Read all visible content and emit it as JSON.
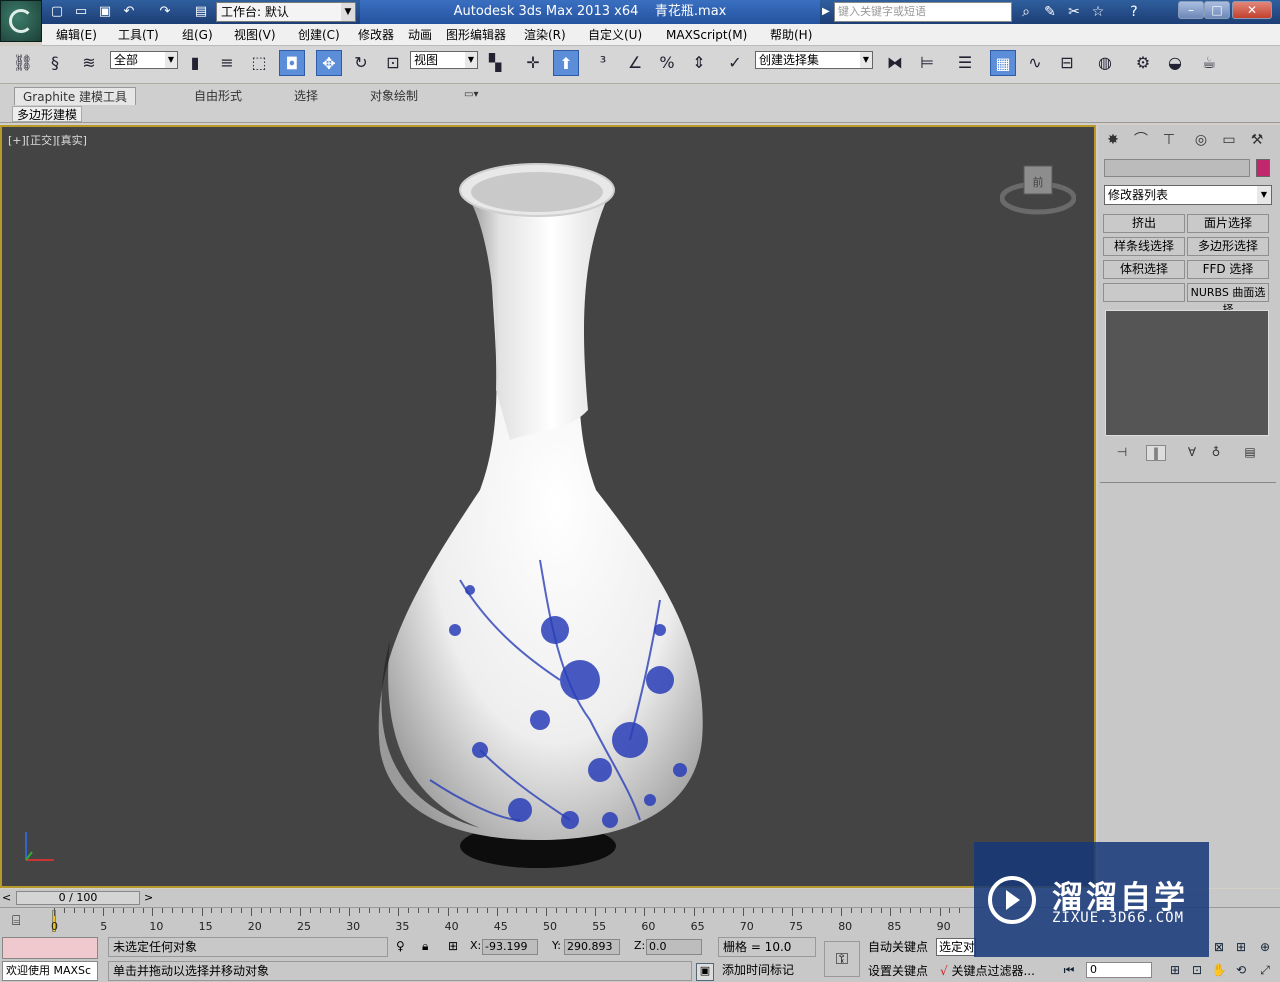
{
  "window": {
    "app_title": "Autodesk 3ds Max  2013 x64",
    "file_name": "青花瓶.max",
    "workspace_label": "工作台: 默认",
    "search_placeholder": "键入关键字或短语",
    "minimize": "–",
    "maximize": "□",
    "close": "✕"
  },
  "menu": [
    "编辑(E)",
    "工具(T)",
    "组(G)",
    "视图(V)",
    "创建(C)",
    "修改器",
    "动画",
    "图形编辑器",
    "渲染(R)",
    "自定义(U)",
    "MAXScript(M)",
    "帮助(H)"
  ],
  "toolbar": {
    "selection_filter": "全部",
    "ref_coord": "视图",
    "named_selection": "创建选择集"
  },
  "ribbon": {
    "tabs": [
      "Graphite 建模工具",
      "自由形式",
      "选择",
      "对象绘制"
    ],
    "panel_label": "多边形建模"
  },
  "viewport": {
    "label": "[+][正交][真实]",
    "viewcube_face": "前"
  },
  "command_panel": {
    "modifier_list": "修改器列表",
    "modifier_buttons": [
      "挤出",
      "面片选择",
      "样条线选择",
      "多边形选择",
      "体积选择",
      "FFD 选择",
      "",
      "NURBS 曲面选择"
    ]
  },
  "timeline": {
    "frame_display": "0 / 100",
    "ticks": [
      0,
      5,
      10,
      15,
      20,
      25,
      30,
      35,
      40,
      45,
      50,
      55,
      60,
      65,
      70,
      75,
      80,
      85,
      90
    ]
  },
  "status": {
    "maxscript_welcome": "欢迎使用 MAXSc",
    "selection_status": "未选定任何对象",
    "prompt": "单击并拖动以选择并移动对象",
    "x_label": "X:",
    "x_value": "-93.199",
    "y_label": "Y:",
    "y_value": "290.893",
    "z_label": "Z:",
    "z_value": "0.0",
    "grid": "栅格 = 10.0",
    "add_time_tag": "添加时间标记",
    "auto_key": "自动关键点",
    "set_key": "设置关键点",
    "selected_set": "选定对象",
    "key_filters": "关键点过滤器...",
    "current_frame": "0"
  },
  "watermark": {
    "title": "溜溜自学",
    "url": "ZIXUE.3D66.COM"
  },
  "colors": {
    "viewport_bg": "#444444",
    "active_border": "#b89a2c",
    "accent_blue": "#5b8dd9",
    "porcelain_blue": "#2a3fb8"
  }
}
